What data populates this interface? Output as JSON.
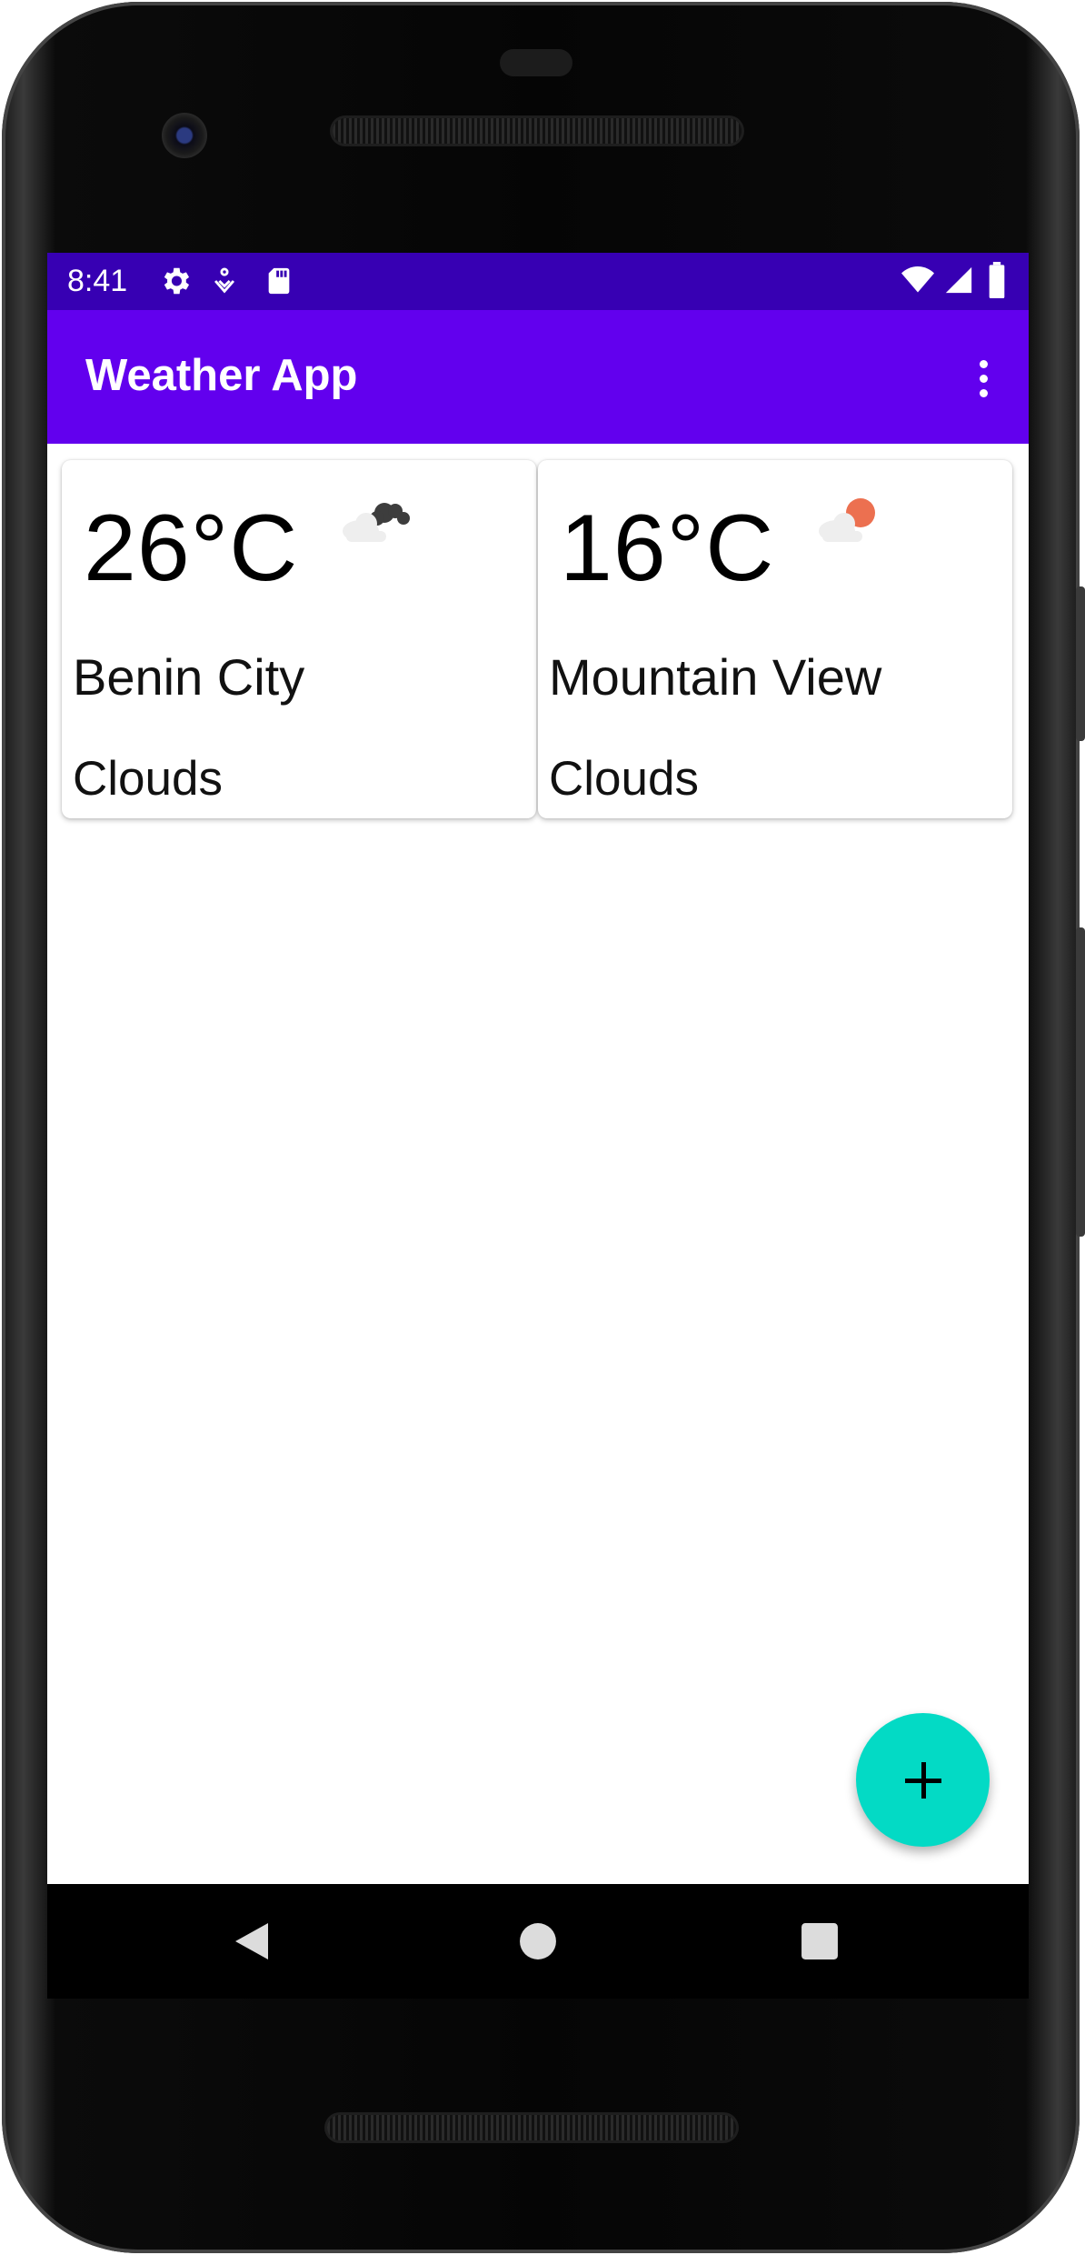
{
  "status_bar": {
    "time": "8:41",
    "left_icons": [
      "settings-icon",
      "accessibility-icon",
      "sd-card-icon"
    ],
    "right_icons": [
      "wifi-icon",
      "signal-icon",
      "battery-icon"
    ],
    "background": "#3700b3"
  },
  "app_bar": {
    "title": "Weather App",
    "background": "#6200ee",
    "overflow_icon": "more-vert-icon"
  },
  "cards": [
    {
      "temperature": "26°C",
      "city": "Benin City",
      "condition": "Clouds",
      "icon": "dark-cloud-icon"
    },
    {
      "temperature": "16°C",
      "city": "Mountain View",
      "condition": "Clouds",
      "icon": "cloud-sun-icon"
    }
  ],
  "fab": {
    "icon": "plus-icon",
    "color": "#03dac5"
  },
  "navigation": {
    "buttons": [
      "back-icon",
      "home-icon",
      "recents-icon"
    ]
  }
}
